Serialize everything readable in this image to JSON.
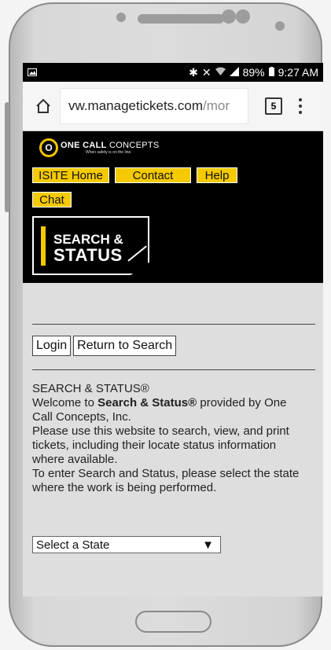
{
  "status_bar": {
    "battery": "89%",
    "time": "9:27 AM"
  },
  "browser": {
    "url_main": "vw.managetickets.com",
    "url_rest": "/mor",
    "tab_count": "5"
  },
  "header": {
    "logo_one": "ONE",
    "logo_call": "CALL",
    "logo_concepts": "CONCEPTS",
    "logo_tagline": "When safety is on the line.",
    "nav": [
      "ISITE Home",
      "Contact",
      "Help",
      "Chat"
    ],
    "badge_line1": "SEARCH &",
    "badge_line2": "STATUS"
  },
  "main": {
    "login_label": "Login",
    "return_label": "Return to Search",
    "heading": "SEARCH & STATUS®",
    "welcome_prefix": "Welcome to ",
    "welcome_bold": "Search & Status®",
    "welcome_suffix": " provided by One Call Concepts, Inc.",
    "para1": "Please use this website to search, view, and print tickets, including their locate status information where available.",
    "para2": "To enter Search and Status, please select the state where the work is being performed.",
    "select_value": "Select a State"
  },
  "colors": {
    "brand_yellow": "#f5ca00",
    "header_black": "#000000"
  }
}
